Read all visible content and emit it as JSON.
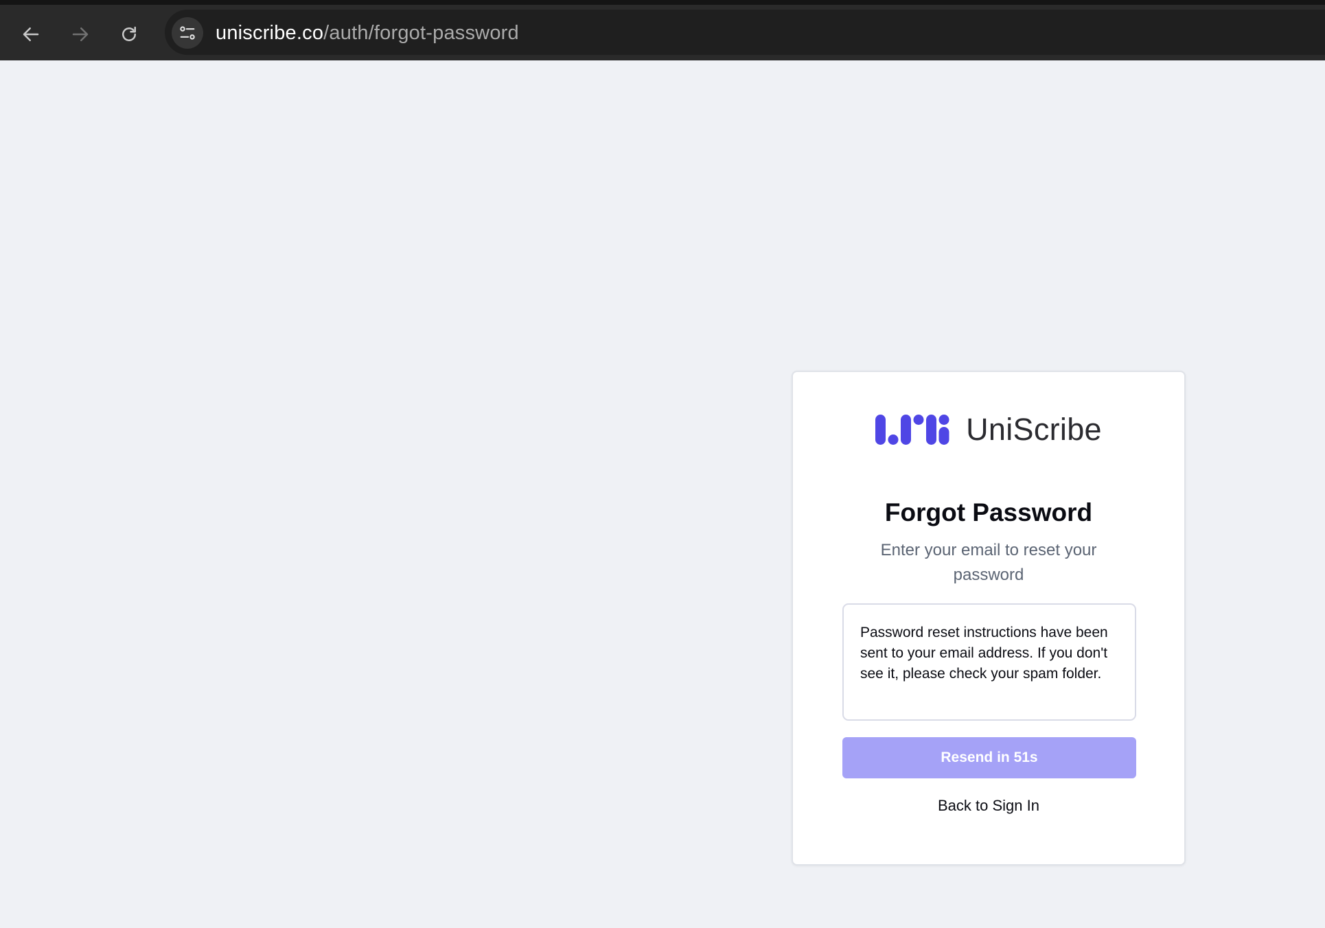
{
  "browser": {
    "url_host": "uniscribe.co",
    "url_path": "/auth/forgot-password",
    "icons": {
      "back": "back-arrow-icon",
      "forward": "forward-arrow-icon",
      "reload": "reload-icon",
      "site_info": "site-settings-icon"
    }
  },
  "brand": {
    "name": "UniScribe",
    "logo": "uniscribe-logo",
    "color": "#4f46e5"
  },
  "form": {
    "title": "Forgot Password",
    "subtitle": "Enter your email to reset your password",
    "notice": "Password reset instructions have been sent to your email address. If you don't see it, please check your spam folder.",
    "resend_label": "Resend in 51s",
    "resend_color": "#a5a2f7",
    "back_link": "Back to Sign In"
  }
}
